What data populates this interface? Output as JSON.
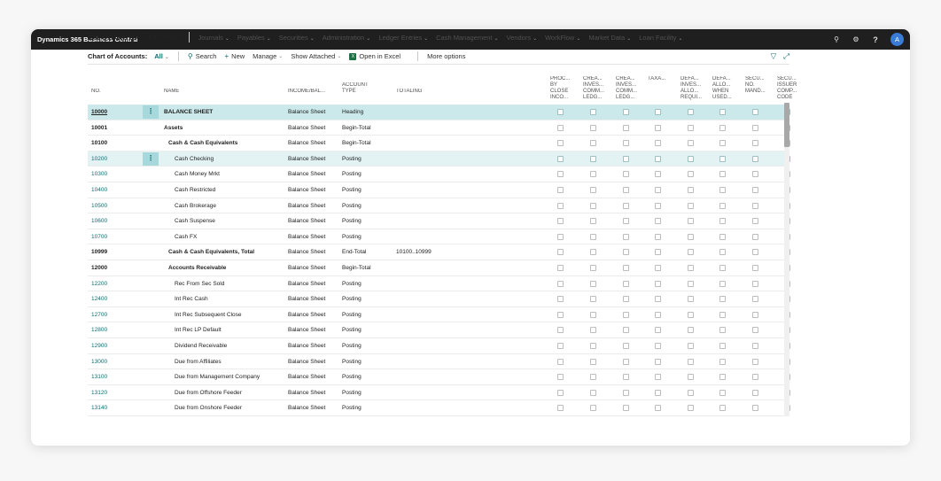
{
  "topbar": {
    "app_title": "Dynamics 365 Business Central",
    "avatar_initial": "A"
  },
  "nav": {
    "company": "Bootcamp October",
    "items": [
      {
        "label": "Journals",
        "has_dropdown": true
      },
      {
        "label": "Payables",
        "has_dropdown": true
      },
      {
        "label": "Securities",
        "has_dropdown": true
      },
      {
        "label": "Administration",
        "has_dropdown": true
      },
      {
        "label": "Ledger Entries",
        "has_dropdown": true
      },
      {
        "label": "Cash Management",
        "has_dropdown": true
      },
      {
        "label": "Vendors",
        "has_dropdown": true
      },
      {
        "label": "WorkFlow",
        "has_dropdown": true
      },
      {
        "label": "Market Data",
        "has_dropdown": true
      },
      {
        "label": "Loan Facility",
        "has_dropdown": true
      }
    ]
  },
  "actions": {
    "page_caption": "Chart of Accounts:",
    "view_filter": "All",
    "search": "Search",
    "new": "New",
    "manage": "Manage",
    "show_attached": "Show Attached",
    "open_excel": "Open in Excel",
    "more_options": "More options",
    "excel_icon_text": "X"
  },
  "columns": {
    "no": "NO.",
    "name": "NAME",
    "income_balance": "INCOME/BAL...",
    "account_type": "ACCOUNT\nTYPE",
    "totaling": "TOTALING",
    "checkbox_columns": [
      "PROC...\nBY\nCLOSE\nINCO...",
      "CREA...\nINVES...\nCOMM...\nLEDG...",
      "CREA...\nINVES...\nCOMM...\nLEDG...",
      "TAXA...",
      "DEFA...\nINVES...\nALLO...\nREQUI...",
      "DEFA...\nALLO...\nWHEN\nUSED...",
      "SECU...\nNO.\nMAND...",
      "SECU...\nISSUER\nCOMP...\nCODE"
    ]
  },
  "rows": [
    {
      "no": "10000",
      "name": "BALANCE SHEET",
      "income_balance": "Balance Sheet",
      "account_type": "Heading",
      "totaling": "",
      "style": "heading",
      "state": "selected"
    },
    {
      "no": "10001",
      "name": "Assets",
      "income_balance": "Balance Sheet",
      "account_type": "Begin-Total",
      "totaling": "",
      "style": "bold1",
      "state": ""
    },
    {
      "no": "10100",
      "name": "Cash & Cash Equivalents",
      "income_balance": "Balance Sheet",
      "account_type": "Begin-Total",
      "totaling": "",
      "style": "bold2",
      "state": ""
    },
    {
      "no": "10200",
      "name": "Cash Checking",
      "income_balance": "Balance Sheet",
      "account_type": "Posting",
      "totaling": "",
      "style": "post",
      "state": "highlight"
    },
    {
      "no": "10300",
      "name": "Cash Money Mrkt",
      "income_balance": "Balance Sheet",
      "account_type": "Posting",
      "totaling": "",
      "style": "post",
      "state": ""
    },
    {
      "no": "10400",
      "name": "Cash Restricted",
      "income_balance": "Balance Sheet",
      "account_type": "Posting",
      "totaling": "",
      "style": "post",
      "state": ""
    },
    {
      "no": "10500",
      "name": "Cash Brokerage",
      "income_balance": "Balance Sheet",
      "account_type": "Posting",
      "totaling": "",
      "style": "post",
      "state": ""
    },
    {
      "no": "10600",
      "name": "Cash Suspense",
      "income_balance": "Balance Sheet",
      "account_type": "Posting",
      "totaling": "",
      "style": "post",
      "state": ""
    },
    {
      "no": "10700",
      "name": "Cash FX",
      "income_balance": "Balance Sheet",
      "account_type": "Posting",
      "totaling": "",
      "style": "post",
      "state": ""
    },
    {
      "no": "10999",
      "name": "Cash & Cash Equivalents, Total",
      "income_balance": "Balance Sheet",
      "account_type": "End-Total",
      "totaling": "10100..10999",
      "style": "bold2",
      "state": ""
    },
    {
      "no": "12000",
      "name": "Accounts Receivable",
      "income_balance": "Balance Sheet",
      "account_type": "Begin-Total",
      "totaling": "",
      "style": "bold2",
      "state": ""
    },
    {
      "no": "12200",
      "name": "Rec From Sec Sold",
      "income_balance": "Balance Sheet",
      "account_type": "Posting",
      "totaling": "",
      "style": "post",
      "state": ""
    },
    {
      "no": "12400",
      "name": "Int Rec Cash",
      "income_balance": "Balance Sheet",
      "account_type": "Posting",
      "totaling": "",
      "style": "post",
      "state": ""
    },
    {
      "no": "12700",
      "name": "Int Rec Subsequent Close",
      "income_balance": "Balance Sheet",
      "account_type": "Posting",
      "totaling": "",
      "style": "post",
      "state": ""
    },
    {
      "no": "12800",
      "name": "Int Rec LP Default",
      "income_balance": "Balance Sheet",
      "account_type": "Posting",
      "totaling": "",
      "style": "post",
      "state": ""
    },
    {
      "no": "12900",
      "name": "Dividend Receivable",
      "income_balance": "Balance Sheet",
      "account_type": "Posting",
      "totaling": "",
      "style": "post",
      "state": ""
    },
    {
      "no": "13000",
      "name": "Due from Affiliates",
      "income_balance": "Balance Sheet",
      "account_type": "Posting",
      "totaling": "",
      "style": "post",
      "state": ""
    },
    {
      "no": "13100",
      "name": "Due from Management Company",
      "income_balance": "Balance Sheet",
      "account_type": "Posting",
      "totaling": "",
      "style": "post",
      "state": ""
    },
    {
      "no": "13120",
      "name": "Due from Offshore Feeder",
      "income_balance": "Balance Sheet",
      "account_type": "Posting",
      "totaling": "",
      "style": "post",
      "state": ""
    },
    {
      "no": "13140",
      "name": "Due from Onshore Feeder",
      "income_balance": "Balance Sheet",
      "account_type": "Posting",
      "totaling": "",
      "style": "post",
      "state": ""
    }
  ],
  "colors": {
    "accent": "#0f6c73",
    "selected_row": "#cbe9eb",
    "topbar": "#1f1f1f"
  }
}
